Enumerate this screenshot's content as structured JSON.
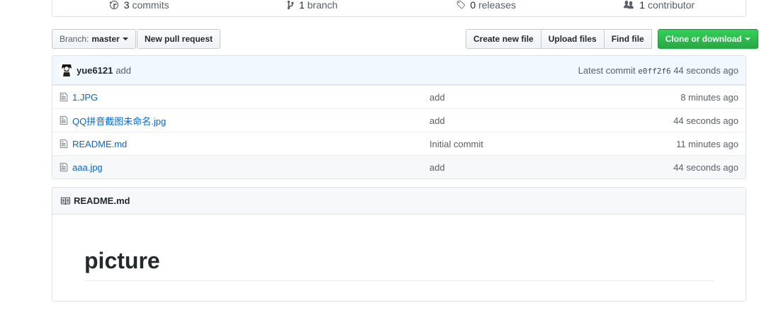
{
  "summary": {
    "commits": {
      "count": "3",
      "label": "commits",
      "icon": "history-icon"
    },
    "branches": {
      "count": "1",
      "label": "branch",
      "icon": "branch-icon"
    },
    "releases": {
      "count": "0",
      "label": "releases",
      "icon": "tag-icon"
    },
    "contributors": {
      "count": "1",
      "label": "contributor",
      "icon": "people-icon"
    }
  },
  "toolbar": {
    "branch_prefix": "Branch:",
    "branch_name": "master",
    "new_pr": "New pull request",
    "create_file": "Create new file",
    "upload_files": "Upload files",
    "find_file": "Find file",
    "clone": "Clone or download"
  },
  "commit": {
    "author": "yue6121",
    "message": "add",
    "latest_label": "Latest commit",
    "sha": "e0ff2f6",
    "age": "44 seconds ago"
  },
  "files": [
    {
      "name": "1.JPG",
      "message": "add",
      "age": "8 minutes ago"
    },
    {
      "name": "QQ拼音截图未命名.jpg",
      "message": "add",
      "age": "44 seconds ago"
    },
    {
      "name": "README.md",
      "message": "Initial commit",
      "age": "11 minutes ago"
    },
    {
      "name": "aaa.jpg",
      "message": "add",
      "age": "44 seconds ago"
    }
  ],
  "readme": {
    "filename": "README.md",
    "heading": "picture"
  },
  "colors": {
    "link": "#0366d6",
    "primary": "#28a745",
    "commit_bg": "#f1f8ff"
  }
}
